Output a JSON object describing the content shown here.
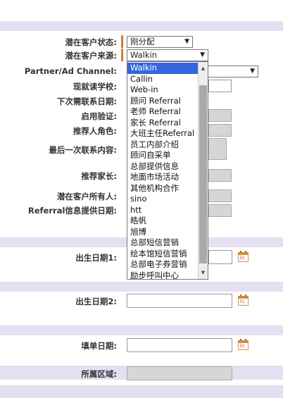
{
  "form": {
    "status_label": "潜在客户状态:",
    "status_value": "刚分配",
    "source_label": "潜在客户来源:",
    "source_value": "Walkin",
    "partner_label": "Partner/Ad Channel:",
    "school_label": "现就读学校:",
    "next_contact_label": "下次需联系日期:",
    "enable_verify_label": "启用验证:",
    "referrer_role_label": "推荐人角色:",
    "last_contact_label": "最后一次联系内容:",
    "referrer_parent_label": "推荐家长:",
    "owner_label": "潜在客户所有人:",
    "referral_date_label": "Referral信息提供日期:",
    "birthdate1_label": "出生日期1:",
    "birthdate2_label": "出生日期2:",
    "fill_date_label": "填单日期:",
    "region_label": "所属区域:"
  },
  "dropdown": {
    "options": [
      "Walkin",
      "Callin",
      "Web-in",
      "顾问 Referral",
      "老师 Referral",
      "家长 Referral",
      "大班主任Referral",
      "员工内部介绍",
      "顾问自采单",
      "总部提供信息",
      "地面市场活动",
      "其他机构合作",
      "sino",
      "htt",
      "皓帆",
      "旭博",
      "总部短信营销",
      "绘本馆短信营销",
      "总部电子券营销",
      "励步呼叫中心"
    ],
    "selected": "Walkin"
  },
  "icons": {
    "calendar": "calendar-icon",
    "scroll_up": "scroll-up-arrow",
    "scroll_down": "scroll-down-arrow",
    "select_arrow": "chevron-down-icon"
  },
  "glyphs": {
    "arrow_down": "▼",
    "scroll_up": "▲",
    "scroll_down": "▼",
    "cal_num": "31"
  },
  "colors": {
    "band": "#e4e0f2",
    "highlight": "#3366dd",
    "marker": "#d97a2b"
  }
}
